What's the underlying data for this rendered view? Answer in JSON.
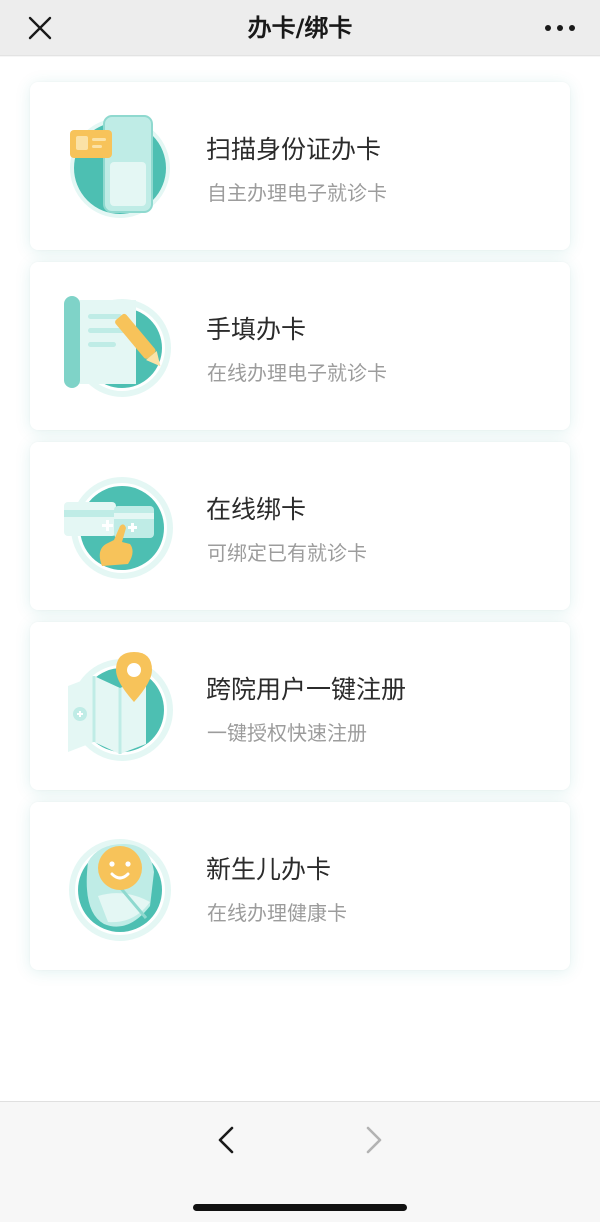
{
  "nav": {
    "title": "办卡/绑卡",
    "close_icon": "close-icon",
    "more_icon": "more-dots-icon"
  },
  "cards": [
    {
      "title": "扫描身份证办卡",
      "subtitle": "自主办理电子就诊卡",
      "icon": "id-card-scan-icon"
    },
    {
      "title": "手填办卡",
      "subtitle": "在线办理电子就诊卡",
      "icon": "form-pen-icon"
    },
    {
      "title": "在线绑卡",
      "subtitle": "可绑定已有就诊卡",
      "icon": "card-bind-hand-icon"
    },
    {
      "title": "跨院用户一键注册",
      "subtitle": "一键授权快速注册",
      "icon": "map-location-icon"
    },
    {
      "title": "新生儿办卡",
      "subtitle": "在线办理健康卡",
      "icon": "newborn-baby-icon"
    }
  ],
  "toolbar": {
    "back_icon": "chevron-left-icon",
    "forward_icon": "chevron-right-icon"
  },
  "colors": {
    "accent": "#4dbfb2",
    "accent_light": "#bfece6",
    "accent_pale": "#e4f7f4",
    "highlight": "#f7c35a"
  }
}
